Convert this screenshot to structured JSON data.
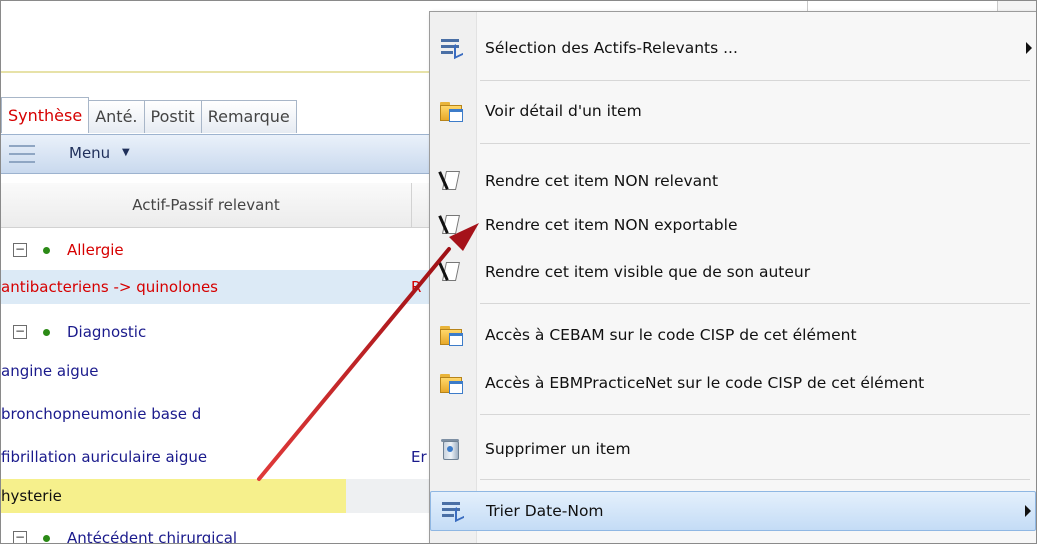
{
  "tabs": [
    {
      "label": "Synthèse",
      "active": true
    },
    {
      "label": "Anté."
    },
    {
      "label": "Postit"
    },
    {
      "label": "Remarque"
    }
  ],
  "toolbar": {
    "menu_label": "Menu"
  },
  "grid": {
    "column_header": "Actif-Passif relevant",
    "rows": [
      {
        "type": "group",
        "label": "Allergie",
        "color": "#d60000",
        "expander": "−"
      },
      {
        "type": "item",
        "label": "antibacteriens -> quinolones",
        "extra": "R",
        "color": "#d60000",
        "selected": true
      },
      {
        "type": "group",
        "label": "Diagnostic",
        "expander": "−"
      },
      {
        "type": "item",
        "label": "angine aigue"
      },
      {
        "type": "item",
        "label": "bronchopneumonie base d"
      },
      {
        "type": "item",
        "label": "fibrillation auriculaire aigue",
        "extra": "Er"
      },
      {
        "type": "item",
        "label": "hysterie",
        "highlighted": true
      },
      {
        "type": "group",
        "label": "Antécédent chirurgical",
        "expander": "−"
      }
    ]
  },
  "context_menu": {
    "items": [
      {
        "label": "Sélection des Actifs-Relevants ...",
        "icon": "list-icon",
        "submenu": true
      },
      {
        "label": "Voir détail d'un item",
        "icon": "folder-detail-icon"
      },
      {
        "label": "Rendre cet item NON relevant",
        "icon": "document-icon"
      },
      {
        "label": "Rendre cet item NON exportable",
        "icon": "document-icon"
      },
      {
        "label": "Rendre cet item visible que de son auteur",
        "icon": "document-icon"
      },
      {
        "label": "Accès à CEBAM sur le code CISP de cet élément",
        "icon": "folder-detail-icon"
      },
      {
        "label": "Accès à EBMPracticeNet sur le code CISP de cet élément",
        "icon": "folder-detail-icon"
      },
      {
        "label": "Supprimer un item",
        "icon": "recycle-bin-icon"
      },
      {
        "label": "Trier Date-Nom",
        "icon": "list-icon",
        "submenu": true,
        "hover": true
      }
    ]
  },
  "colors": {
    "accent_red": "#d60000",
    "link_blue": "#1a1a8c",
    "arrow": "#c0161c"
  }
}
